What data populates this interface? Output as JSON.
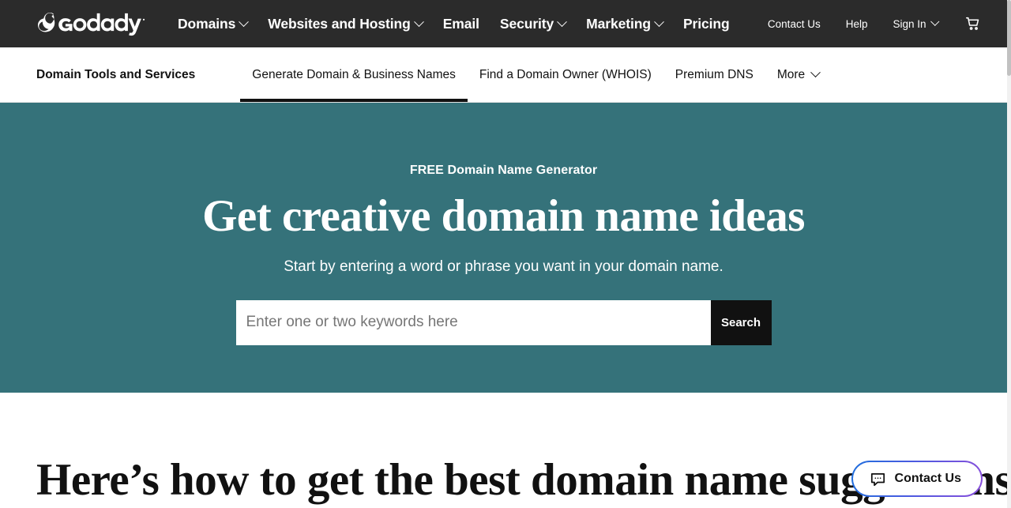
{
  "header": {
    "logo_name": "GoDaddy",
    "main_nav": [
      {
        "label": "Domains",
        "has_caret": true
      },
      {
        "label": "Websites and Hosting",
        "has_caret": true
      },
      {
        "label": "Email",
        "has_caret": false
      },
      {
        "label": "Security",
        "has_caret": true
      },
      {
        "label": "Marketing",
        "has_caret": true
      },
      {
        "label": "Pricing",
        "has_caret": false
      }
    ],
    "util_nav": [
      {
        "label": "Contact Us",
        "has_caret": false
      },
      {
        "label": "Help",
        "has_caret": false
      },
      {
        "label": "Sign In",
        "has_caret": true
      }
    ],
    "cart_icon": "shopping-cart-icon"
  },
  "subnav": {
    "title": "Domain Tools and Services",
    "items": [
      {
        "label": "Generate Domain & Business Names",
        "active": true,
        "has_caret": false
      },
      {
        "label": "Find a Domain Owner (WHOIS)",
        "active": false,
        "has_caret": false
      },
      {
        "label": "Premium DNS",
        "active": false,
        "has_caret": false
      },
      {
        "label": "More",
        "active": false,
        "has_caret": true
      }
    ]
  },
  "hero": {
    "eyebrow": "FREE Domain Name Generator",
    "title": "Get creative domain name ideas",
    "subtitle": "Start by entering a word or phrase you want in your domain name.",
    "search_placeholder": "Enter one or two keywords here",
    "search_value": "",
    "search_button": "Search",
    "background_color": "#35727a"
  },
  "section": {
    "title": "Here’s how to get the best domain name suggestions"
  },
  "contact_widget": {
    "label": "Contact Us",
    "icon": "chat-bubble-icon",
    "border_gradient_start": "#1f6fdd",
    "border_gradient_end": "#8a4fdb"
  }
}
